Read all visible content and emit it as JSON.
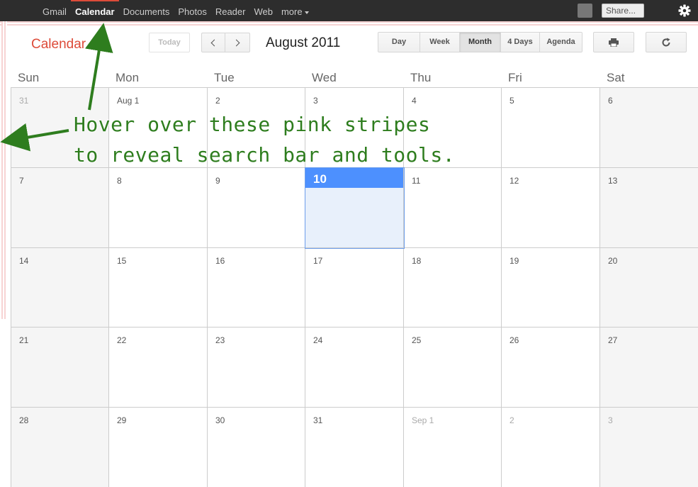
{
  "topbar": {
    "nav": [
      {
        "label": "Gmail",
        "active": false
      },
      {
        "label": "Calendar",
        "active": true
      },
      {
        "label": "Documents",
        "active": false
      },
      {
        "label": "Photos",
        "active": false
      },
      {
        "label": "Reader",
        "active": false
      },
      {
        "label": "Web",
        "active": false
      },
      {
        "label": "more",
        "active": false
      }
    ],
    "share_label": "Share..."
  },
  "app_title": "Calendar",
  "toolbar": {
    "today_label": "Today",
    "current_period": "August 2011",
    "views": [
      {
        "label": "Day",
        "active": false
      },
      {
        "label": "Week",
        "active": false
      },
      {
        "label": "Month",
        "active": true
      },
      {
        "label": "4 Days",
        "active": false
      },
      {
        "label": "Agenda",
        "active": false
      }
    ]
  },
  "calendar": {
    "days_of_week": [
      "Sun",
      "Mon",
      "Tue",
      "Wed",
      "Thu",
      "Fri",
      "Sat"
    ],
    "weeks": [
      [
        {
          "label": "31",
          "other": true
        },
        {
          "label": "Aug 1"
        },
        {
          "label": "2"
        },
        {
          "label": "3"
        },
        {
          "label": "4"
        },
        {
          "label": "5"
        },
        {
          "label": "6"
        }
      ],
      [
        {
          "label": "7"
        },
        {
          "label": "8"
        },
        {
          "label": "9"
        },
        {
          "label": "10",
          "today": true
        },
        {
          "label": "11"
        },
        {
          "label": "12"
        },
        {
          "label": "13"
        }
      ],
      [
        {
          "label": "14"
        },
        {
          "label": "15"
        },
        {
          "label": "16"
        },
        {
          "label": "17"
        },
        {
          "label": "18"
        },
        {
          "label": "19"
        },
        {
          "label": "20"
        }
      ],
      [
        {
          "label": "21"
        },
        {
          "label": "22"
        },
        {
          "label": "23"
        },
        {
          "label": "24"
        },
        {
          "label": "25"
        },
        {
          "label": "26"
        },
        {
          "label": "27"
        }
      ],
      [
        {
          "label": "28"
        },
        {
          "label": "29"
        },
        {
          "label": "30"
        },
        {
          "label": "31"
        },
        {
          "label": "Sep 1",
          "other": true
        },
        {
          "label": "2",
          "other": true
        },
        {
          "label": "3",
          "other": true
        }
      ]
    ]
  },
  "annotation": {
    "line1": "Hover over these pink stripes",
    "line2": "to reveal search bar and tools.",
    "color": "#2e7d1e"
  },
  "colors": {
    "brand_red": "#dd4b39",
    "today_blue": "#4d90fe",
    "pink_stripe": "#f7d3d3"
  }
}
